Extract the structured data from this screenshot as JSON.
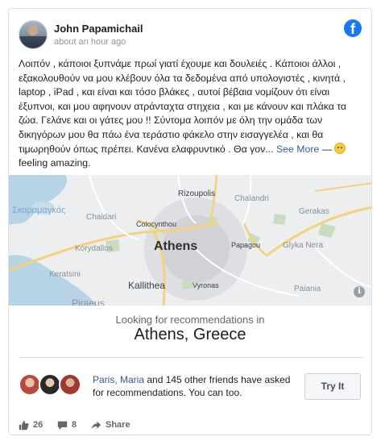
{
  "post": {
    "author": "John Papamichail",
    "timestamp": "about an hour ago",
    "body": "Λοιπόν , κάποιοι ξυπνάμε πρωί γιατί έχουμε και δουλειές . Κάποιοι άλλοι , εξακολουθούν να μου κλέβουν όλα τα δεδομένα από υπολογιστές , κινητά , laptop , iPad , και είναι και τόσο βλάκες , αυτοί βέβαια νομίζουν ότι είναι έξυπνοι, και μου αφηνουν ατράνταχτα στηχεια , και με κάνουν και πλάκα τα ζώα. Γελάνε και οι γάτες μου !! Σύντομα λοιπόν με όλη την ομάδα των δικηγόρων μου θα πάω ένα τεράστιο φάκελο στην εισαγγελέα , και θα τιμωρηθούν όπως πρέπει. Κανένα ελαφρυντικό . Θα γον...",
    "see_more": "See More",
    "feeling_dash": "—",
    "feeling": "feeling amazing."
  },
  "map": {
    "labels": {
      "rizoupolis": "Rizoupolis",
      "chalandri": "Chalandri",
      "skaramangas": "Σκαραμαγκάς",
      "chaidari": "Chaidari",
      "colocynthou": "Colocynthou",
      "gerakas": "Gerakas",
      "korydallos": "Korydallos",
      "athens": "Athens",
      "papagou": "Papagou",
      "glyka_nera": "Glyka Nera",
      "keratsini": "Keratsini",
      "kallithea": "Kallithea",
      "vyronas": "Vyronas",
      "paiania": "Paiania",
      "piraeus": "Piraeus"
    },
    "info_glyph": "i"
  },
  "recommendation": {
    "caption": "Looking for recommendations in",
    "location": "Athens, Greece",
    "friend_names": "Paris, Maria",
    "friends_text": " and 145 other friends have asked for recommendations. You can too.",
    "button": "Try It"
  },
  "footer": {
    "likes": "26",
    "comments": "8",
    "share": "Share"
  },
  "colors": {
    "facebook_blue": "#1877f2",
    "link_blue": "#385898"
  },
  "icons": [
    "facebook-logo-icon",
    "info-icon",
    "like-icon",
    "comment-icon",
    "share-icon",
    "smiley-emoji-icon"
  ]
}
